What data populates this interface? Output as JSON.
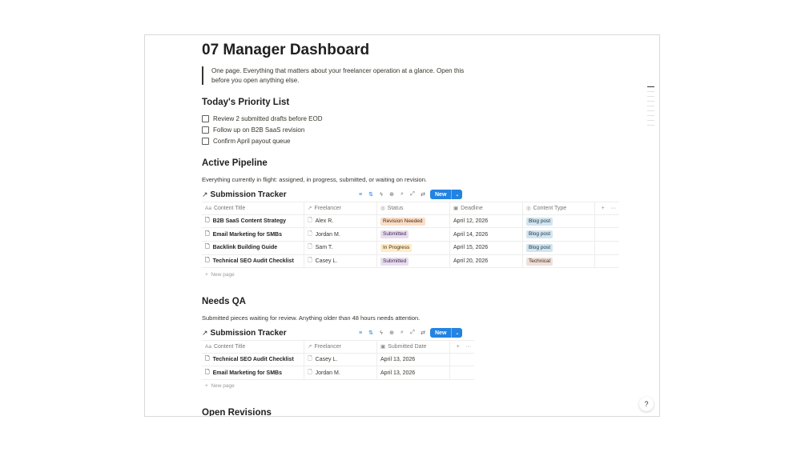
{
  "page": {
    "title": "07 Manager Dashboard",
    "intro": "One page. Everything that matters about your freelancer operation at a glance. Open this before you open anything else."
  },
  "priority": {
    "heading": "Today's Priority List",
    "items": [
      {
        "label": "Review 2 submitted drafts before EOD",
        "checked": false
      },
      {
        "label": "Follow up on B2B SaaS revision",
        "checked": false
      },
      {
        "label": "Confirm April payout queue",
        "checked": false
      }
    ]
  },
  "pipeline": {
    "heading": "Active Pipeline",
    "description": "Everything currently in flight: assigned, in progress, submitted, or waiting on revision.",
    "db_title": "Submission Tracker",
    "new_label": "New",
    "columns": [
      "Content Title",
      "Freelancer",
      "Status",
      "Deadline",
      "Content Type"
    ],
    "rows": [
      {
        "title": "B2B SaaS Content Strategy",
        "freelancer": "Alex R.",
        "status": "Revision Needed",
        "deadline": "April 12, 2026",
        "type": "Blog post"
      },
      {
        "title": "Email Marketing for SMBs",
        "freelancer": "Jordan M.",
        "status": "Submitted",
        "deadline": "April 14, 2026",
        "type": "Blog post"
      },
      {
        "title": "Backlink Building Guide",
        "freelancer": "Sam T.",
        "status": "In Progress",
        "deadline": "April 15, 2026",
        "type": "Blog post"
      },
      {
        "title": "Technical SEO Audit Checklist",
        "freelancer": "Casey L.",
        "status": "Submitted",
        "deadline": "April 20, 2026",
        "type": "Technical"
      }
    ],
    "new_page": "New page"
  },
  "qa": {
    "heading": "Needs QA",
    "description": "Submitted pieces waiting for review. Anything older than 48 hours needs attention.",
    "db_title": "Submission Tracker",
    "new_label": "New",
    "columns": [
      "Content Title",
      "Freelancer",
      "Submitted Date"
    ],
    "rows": [
      {
        "title": "Technical SEO Audit Checklist",
        "freelancer": "Casey L.",
        "submitted": "April 13, 2026"
      },
      {
        "title": "Email Marketing for SMBs",
        "freelancer": "Jordan M.",
        "submitted": "April 13, 2026"
      }
    ],
    "new_page": "New page"
  },
  "revisions": {
    "heading": "Open Revisions"
  },
  "colors": {
    "accent": "#2383e2",
    "text": "#37352f"
  },
  "icons": {
    "db_link": "arrow-up-right-icon",
    "filter": "filter-icon",
    "sort": "sort-icon",
    "lightning": "automation-icon",
    "search": "search-icon",
    "expand": "expand-icon",
    "settings": "settings-icon",
    "help": "help-icon"
  }
}
